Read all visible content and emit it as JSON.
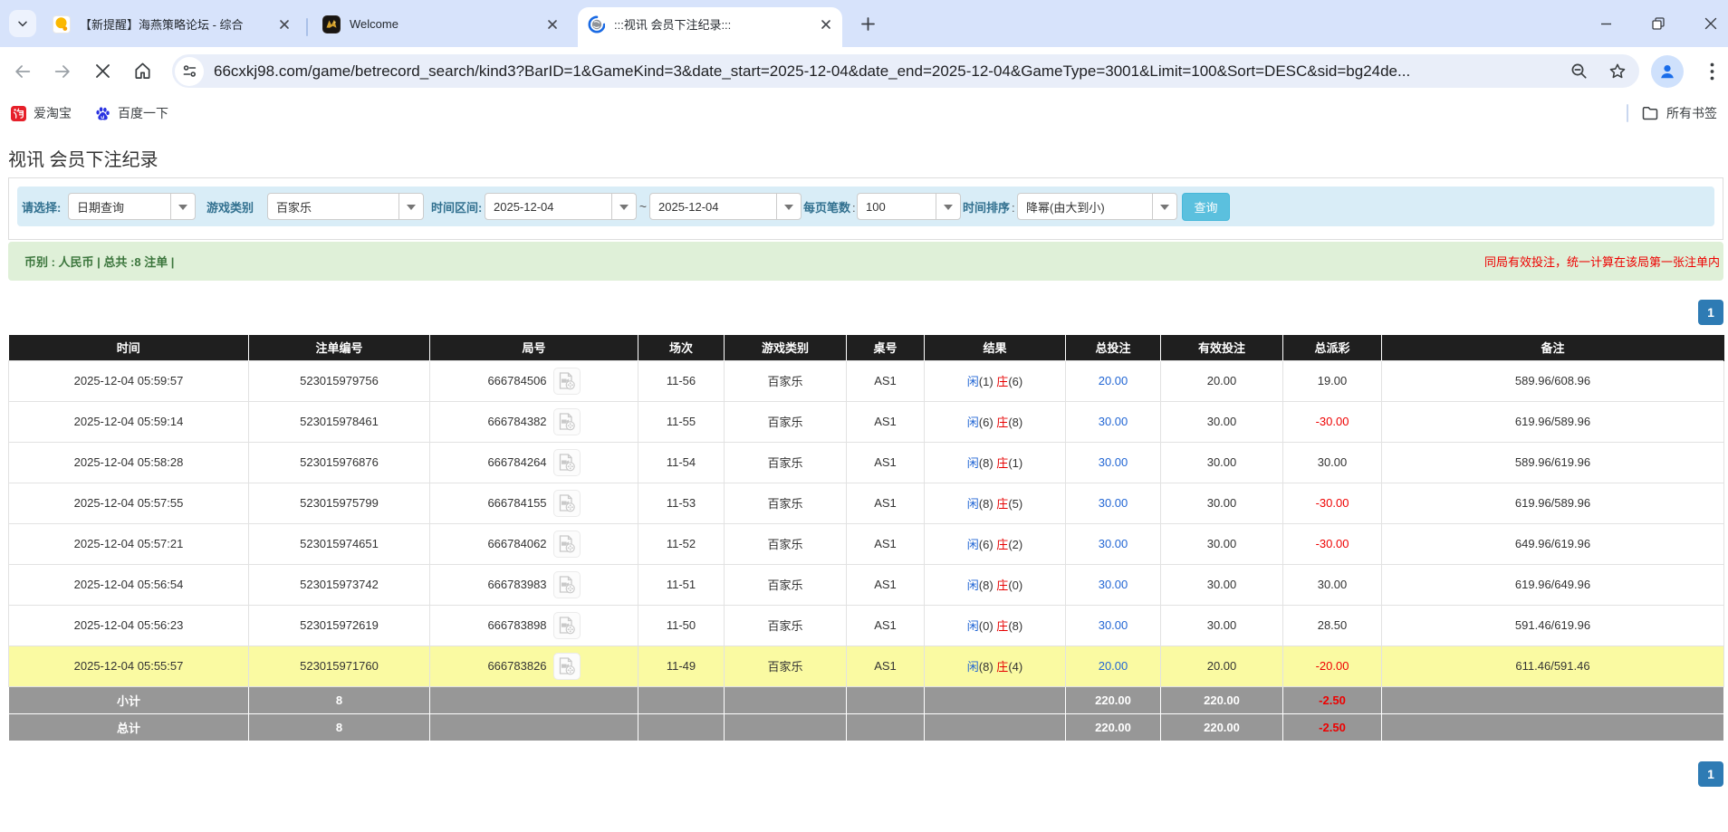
{
  "browser": {
    "tabs": [
      {
        "title": "【新提醒】海燕策略论坛 - 综合",
        "active": false,
        "favicon": "forum-orange-icon"
      },
      {
        "title": "Welcome",
        "active": false,
        "favicon": "gold-emblem-icon"
      },
      {
        "title": ":::视讯 会员下注纪录:::",
        "active": true,
        "favicon": "loading-spinner-icon"
      }
    ],
    "url": "66cxkj98.com/game/betrecord_search/kind3?BarID=1&GameKind=3&date_start=2025-12-04&date_end=2025-12-04&GameType=3001&Limit=100&Sort=DESC&sid=bg24de...",
    "bookmarks": [
      {
        "label": "爱淘宝",
        "icon": "taobao-icon"
      },
      {
        "label": "百度一下",
        "icon": "baidu-icon"
      }
    ],
    "all_bookmarks_label": "所有书签"
  },
  "page": {
    "title": "视讯 会员下注纪录",
    "filters": {
      "select_label": "请选择:",
      "select_value": "日期查询",
      "game_type_label": "游戏类别",
      "game_type_value": "百家乐",
      "date_range_label": "时间区间:",
      "date_start": "2025-12-04",
      "date_separator": "~",
      "date_end": "2025-12-04",
      "page_size_label": "每页笔数",
      "page_size_colon": ":",
      "page_size_value": "100",
      "sort_label": "时间排序",
      "sort_colon": ":",
      "sort_value": "降幂(由大到小)",
      "search_button_label": "查询"
    },
    "info_bar": {
      "left": "币别 : 人民币 | 总共 :8 注单 |",
      "right": "同局有效投注，统一计算在该局第一张注单内"
    },
    "pagination": "1",
    "table": {
      "headers": [
        "时间",
        "注单编号",
        "局号",
        "场次",
        "游戏类别",
        "桌号",
        "结果",
        "总投注",
        "有效投注",
        "总派彩",
        "备注"
      ],
      "rows": [
        {
          "time": "2025-12-04 05:59:57",
          "bet_id": "523015979756",
          "round": "666784506",
          "session": "11-56",
          "game": "百家乐",
          "table": "AS1",
          "result": {
            "player_label": "闲",
            "player_score": "(1)",
            "banker_label": "庄",
            "banker_score": "(6)"
          },
          "total_bet": "20.00",
          "valid_bet": "20.00",
          "payout": "19.00",
          "note": "589.96/608.96",
          "highlight": false
        },
        {
          "time": "2025-12-04 05:59:14",
          "bet_id": "523015978461",
          "round": "666784382",
          "session": "11-55",
          "game": "百家乐",
          "table": "AS1",
          "result": {
            "player_label": "闲",
            "player_score": "(6)",
            "banker_label": "庄",
            "banker_score": "(8)"
          },
          "total_bet": "30.00",
          "valid_bet": "30.00",
          "payout": "-30.00",
          "note": "619.96/589.96",
          "highlight": false
        },
        {
          "time": "2025-12-04 05:58:28",
          "bet_id": "523015976876",
          "round": "666784264",
          "session": "11-54",
          "game": "百家乐",
          "table": "AS1",
          "result": {
            "player_label": "闲",
            "player_score": "(8)",
            "banker_label": "庄",
            "banker_score": "(1)"
          },
          "total_bet": "30.00",
          "valid_bet": "30.00",
          "payout": "30.00",
          "note": "589.96/619.96",
          "highlight": false
        },
        {
          "time": "2025-12-04 05:57:55",
          "bet_id": "523015975799",
          "round": "666784155",
          "session": "11-53",
          "game": "百家乐",
          "table": "AS1",
          "result": {
            "player_label": "闲",
            "player_score": "(8)",
            "banker_label": "庄",
            "banker_score": "(5)"
          },
          "total_bet": "30.00",
          "valid_bet": "30.00",
          "payout": "-30.00",
          "note": "619.96/589.96",
          "highlight": false
        },
        {
          "time": "2025-12-04 05:57:21",
          "bet_id": "523015974651",
          "round": "666784062",
          "session": "11-52",
          "game": "百家乐",
          "table": "AS1",
          "result": {
            "player_label": "闲",
            "player_score": "(6)",
            "banker_label": "庄",
            "banker_score": "(2)"
          },
          "total_bet": "30.00",
          "valid_bet": "30.00",
          "payout": "-30.00",
          "note": "649.96/619.96",
          "highlight": false
        },
        {
          "time": "2025-12-04 05:56:54",
          "bet_id": "523015973742",
          "round": "666783983",
          "session": "11-51",
          "game": "百家乐",
          "table": "AS1",
          "result": {
            "player_label": "闲",
            "player_score": "(8)",
            "banker_label": "庄",
            "banker_score": "(0)"
          },
          "total_bet": "30.00",
          "valid_bet": "30.00",
          "payout": "30.00",
          "note": "619.96/649.96",
          "highlight": false
        },
        {
          "time": "2025-12-04 05:56:23",
          "bet_id": "523015972619",
          "round": "666783898",
          "session": "11-50",
          "game": "百家乐",
          "table": "AS1",
          "result": {
            "player_label": "闲",
            "player_score": "(0)",
            "banker_label": "庄",
            "banker_score": "(8)"
          },
          "total_bet": "30.00",
          "valid_bet": "30.00",
          "payout": "28.50",
          "note": "591.46/619.96",
          "highlight": false
        },
        {
          "time": "2025-12-04 05:55:57",
          "bet_id": "523015971760",
          "round": "666783826",
          "session": "11-49",
          "game": "百家乐",
          "table": "AS1",
          "result": {
            "player_label": "闲",
            "player_score": "(8)",
            "banker_label": "庄",
            "banker_score": "(4)"
          },
          "total_bet": "20.00",
          "valid_bet": "20.00",
          "payout": "-20.00",
          "note": "611.46/591.46",
          "highlight": true
        }
      ],
      "subtotal": {
        "label": "小计",
        "count": "8",
        "total_bet": "220.00",
        "valid_bet": "220.00",
        "payout": "-2.50"
      },
      "total": {
        "label": "总计",
        "count": "8",
        "total_bet": "220.00",
        "valid_bet": "220.00",
        "payout": "-2.50"
      }
    }
  }
}
